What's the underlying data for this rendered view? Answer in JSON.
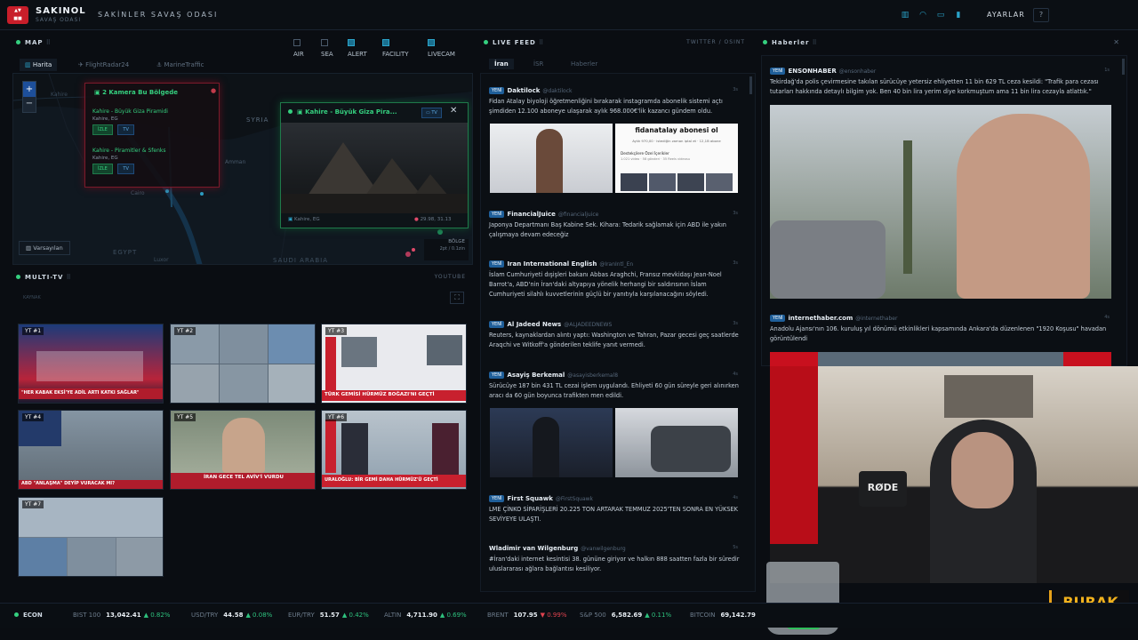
{
  "app": {
    "brand": "SAKINOL",
    "brand_sub": "SAVAŞ ODASI",
    "room_title": "SAKİNLER SAVAŞ ODASI",
    "settings_label": "AYARLAR",
    "help_label": "?",
    "accent": "#2aa3c9"
  },
  "map_panel": {
    "header": "MAP",
    "filters": [
      {
        "label": "AIR",
        "checked": false
      },
      {
        "label": "SEA",
        "checked": false
      },
      {
        "label": "ALERT",
        "checked": true
      },
      {
        "label": "FACILITY",
        "checked": true
      },
      {
        "label": "LIVECAM",
        "checked": true
      }
    ],
    "tabs": [
      "Harita",
      "FlightRadar24",
      "MarineTraffic"
    ],
    "labels": {
      "syria": "SYRIA",
      "egypt": "EGYPT",
      "saudi": "SAUDI ARABIA",
      "cairo": "Cairo",
      "luxor": "Luxor",
      "kahire": "Kahire",
      "amman": "Amman"
    },
    "camera_popup": {
      "title": "2 Kamera Bu Bölgede",
      "items": [
        {
          "name": "Kahire - Büyük Giza Piramidi",
          "loc": "Kahire, EG",
          "btn1": "İZLE",
          "btn2": "TV"
        },
        {
          "name": "Kahire - Piramitler & Sfenks",
          "loc": "Kahire, EG",
          "btn1": "İZLE",
          "btn2": "TV"
        }
      ]
    },
    "live_popup": {
      "title": "Kahire - Büyük Giza Pira...",
      "tv_label": "TV",
      "close": "✕",
      "location": "Kahire, EG",
      "coords": "29.98, 31.13"
    },
    "default_btn": "Varsayılan",
    "region_label": "BÖLGE",
    "region_sub": "2pt / 0.1zin"
  },
  "multitv": {
    "header": "MULTI-TV",
    "right": "YOUTUBE",
    "sub": "KAYNAK",
    "tiles": [
      {
        "label": "YT #1",
        "caption": "\"HER KABAK EKSİ'YE ADİL ARTI KATKI SAĞLAR\""
      },
      {
        "label": "YT #2",
        "caption": ""
      },
      {
        "label": "YT #3",
        "caption": "TÜRK GEMİSİ HÜRMÜZ BOĞAZI'NI GEÇTİ"
      },
      {
        "label": "YT #4",
        "caption": "ABD \"ANLAŞMA\" DEYİP VURACAK MI?"
      },
      {
        "label": "YT #5",
        "caption": "İRAN GECE TEL AVİV'İ VURDU"
      },
      {
        "label": "YT #6",
        "caption": "URALOĞLU: BİR GEMİ DAHA HÜRMÜZ'Ü GEÇTİ"
      },
      {
        "label": "YT #7",
        "caption": ""
      }
    ]
  },
  "live_feed": {
    "header": "LIVE FEED",
    "right": "TWITTER / OSINT",
    "tabs": [
      "İran",
      "İSR",
      "Haberler"
    ],
    "badge": "YENİ",
    "items": [
      {
        "name": "Daktilock",
        "handle": "@daktilock",
        "time": "3s",
        "text": "Fidan Atalay biyoloji öğretmenliğini bırakarak instagramda abonelik sistemi açtı şimdiden 12.100 aboneye ulaşarak aylık 968.000€'lik kazancı gündem oldu."
      },
      {
        "name": "FinancialJuice",
        "handle": "@financialjuice",
        "time": "3s",
        "text": "Japonya Departmanı Baş Kabine Sek. Kihara: Tedarik sağlamak için ABD ile yakın çalışmaya devam edeceğiz"
      },
      {
        "name": "Iran International English",
        "handle": "@IranIntl_En",
        "time": "3s",
        "text": "İslam Cumhuriyeti dışişleri bakanı Abbas Araghchi, Fransız mevkidaşı Jean-Noel Barrot'a, ABD'nin İran'daki altyapıya yönelik herhangi bir saldırısının İslam Cumhuriyeti silahlı kuvvetlerinin güçlü bir yanıtıyla karşılanacağını söyledi."
      },
      {
        "name": "Al Jadeed News",
        "handle": "@ALJADEEDNEWS",
        "time": "3s",
        "text": "Reuters, kaynaklardan alıntı yaptı: Washington ve Tahran, Pazar gecesi geç saatlerde Araqchi ve Witkoff'a gönderilen teklife yanıt vermedi."
      },
      {
        "name": "Asayiş Berkemal",
        "handle": "@asayisberkemal8",
        "time": "4s",
        "text": "Sürücüye 187 bin 431 TL cezai işlem uygulandı. Ehliyeti 60 gün süreyle geri alınırken aracı da 60 gün boyunca trafikten men edildi."
      },
      {
        "name": "First Squawk",
        "handle": "@FirstSquawk",
        "time": "4s",
        "text": "LME ÇİNKO SİPARİŞLERİ 20.225 TON ARTARAK TEMMUZ 2025'TEN SONRA EN YÜKSEK SEVİYEYE ULAŞTI."
      },
      {
        "name": "Wladimir van Wilgenburg",
        "handle": "@vanwilgenburg",
        "time": "5s",
        "text": "#İran'daki internet kesintisi 38. gününe giriyor ve halkın 888 saatten fazla bir süredir uluslararası ağlara bağlantısı kesiliyor."
      }
    ],
    "card_title": "fidanatalay abonesi ol",
    "card_sub1": "Aylık 970,00 · istediğin zaman iptal et · 12,1B abone",
    "card_sub2": "Destekçilere Özel İçerikler",
    "card_sub3": "1.021 video · 58 gönderi · 35 Reels videosu"
  },
  "news": {
    "header": "Haberler",
    "close": "✕",
    "badge": "YENİ",
    "items": [
      {
        "name": "ENSONHABER",
        "handle": "@ensonhaber",
        "time": "1s",
        "text": "Tekirdağ'da polis çevirmesine takılan sürücüye yetersiz ehliyetten 11 bin 629 TL ceza kesildi: \"Trafik para cezası tutarları hakkında detaylı bilgim yok. Ben 40 bin lira yerim diye korkmuştum ama 11 bin lira cezayla atlattık.\""
      },
      {
        "name": "internethaber.com",
        "handle": "@internethaber",
        "time": "4s",
        "text": "Anadolu Ajansı'nın 106. kuruluş yıl dönümü etkinlikleri kapsamında Ankara'da düzenlenen \"1920 Koşusu\" havadan görüntülendi"
      }
    ]
  },
  "ticker": {
    "label": "ECON",
    "items": [
      {
        "name": "BIST 100",
        "value": "13,042.41",
        "change": "▲ 0.82%",
        "dir": "up"
      },
      {
        "name": "USD/TRY",
        "value": "44.58",
        "change": "▲ 0.08%",
        "dir": "up"
      },
      {
        "name": "EUR/TRY",
        "value": "51.57",
        "change": "▲ 0.42%",
        "dir": "up"
      },
      {
        "name": "ALTIN",
        "value": "4,711.90",
        "change": "▲ 0.69%",
        "dir": "up"
      },
      {
        "name": "BRENT",
        "value": "107.95",
        "change": "▼ 0.99%",
        "dir": "dn"
      },
      {
        "name": "S&P 500",
        "value": "6,582.69",
        "change": "▲ 0.11%",
        "dir": "up"
      },
      {
        "name": "BITCOIN",
        "value": "69,142.79",
        "change": "",
        "dir": "up"
      }
    ]
  },
  "streamer": {
    "name": "BURAK",
    "mic_brand": "RØDE"
  }
}
